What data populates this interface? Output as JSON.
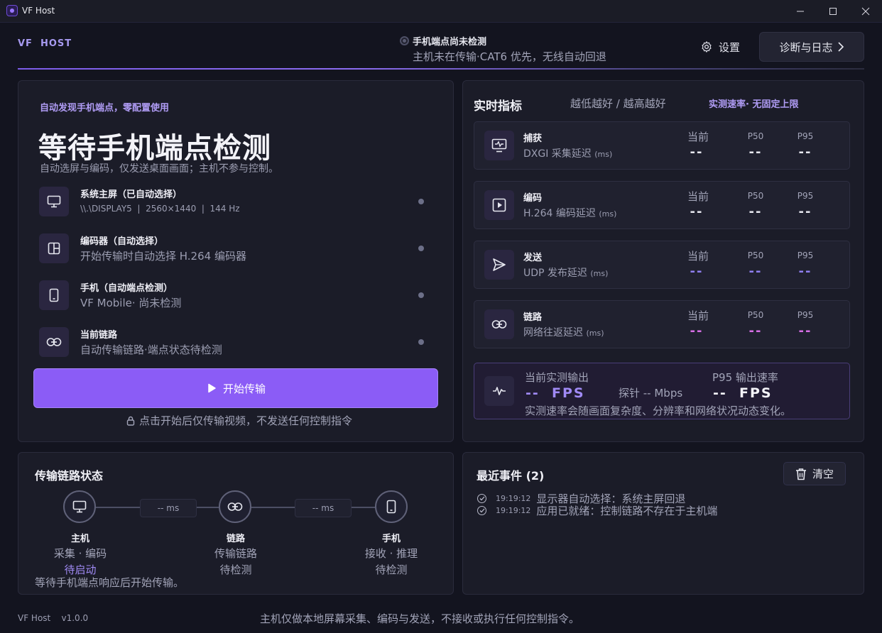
{
  "window": {
    "title": "VF Host",
    "minimize": "—",
    "maximize": "☐",
    "close": "✕"
  },
  "header": {
    "brand": "VF  HOST",
    "status_title": "手机端点尚未检测",
    "status_sub": "主机未在传输·CAT6 优先，无线自动回退",
    "settings_label": "设置",
    "diag_label": "诊断与日志",
    "diag_chevron": "›"
  },
  "main": {
    "tagline": "自动发现手机端点，零配置使用",
    "headline": "等待手机端点检测",
    "subline": "自动选屏与编码，仅发送桌面画面；主机不参与控制。",
    "rows": [
      {
        "title": "系统主屏（已自动选择）",
        "sub": "\\\\.\\DISPLAY5  |  2560×1440  |  144 Hz",
        "icon": "monitor-icon"
      },
      {
        "title": "编码器（自动选择）",
        "sub": "开始传输时自动选择 H.264 编码器",
        "icon": "encoder-icon"
      },
      {
        "title": "手机（自动端点检测）",
        "sub": "VF Mobile· 尚未检测",
        "icon": "phone-icon"
      },
      {
        "title": "当前链路",
        "sub": "自动传输链路·端点状态待检测",
        "icon": "link-icon"
      }
    ],
    "start_button": "开始传输",
    "lock_note": "点击开始后仅传输视频，不发送任何控制指令"
  },
  "metrics": {
    "title": "实时指标",
    "hint": "越低越好 / 越高越好",
    "rate_note": "实测速率· 无固定上限",
    "col_current": "当前",
    "col_p50": "P50",
    "col_p95": "P95",
    "cards": [
      {
        "name": "捕获",
        "sub": "DXGI 采集延迟",
        "unit": "(ms)",
        "cur": "--",
        "p50": "--",
        "p95": "--",
        "color": "#e6e7ef",
        "icon": "capture-icon"
      },
      {
        "name": "编码",
        "sub": "H.264 编码延迟",
        "unit": "(ms)",
        "cur": "--",
        "p50": "--",
        "p95": "--",
        "color": "#e6e7ef",
        "icon": "encode-icon"
      },
      {
        "name": "发送",
        "sub": "UDP 发布延迟",
        "unit": "(ms)",
        "cur": "--",
        "p50": "--",
        "p95": "--",
        "color": "#8f7ff0",
        "icon": "send-icon"
      },
      {
        "name": "链路",
        "sub": "网络往返延迟",
        "unit": "(ms)",
        "cur": "--",
        "p50": "--",
        "p95": "--",
        "color": "#d66ee6",
        "icon": "link-icon"
      }
    ],
    "fps": {
      "label_current": "当前实测输出",
      "value_current": "--",
      "unit_current": "FPS",
      "probe": "探针 -- Mbps",
      "label_p95": "P95 输出速率",
      "value_p95": "--",
      "unit_p95": "FPS",
      "note": "实测速率会随画面复杂度、分辨率和网络状况动态变化。"
    }
  },
  "link_status": {
    "title": "传输链路状态",
    "ms_left": "-- ms",
    "ms_right": "-- ms",
    "nodes": [
      {
        "title": "主机",
        "line1": "采集 · 编码",
        "line2": "待启动"
      },
      {
        "title": "链路",
        "line1": "传输链路",
        "line2": "待检测"
      },
      {
        "title": "手机",
        "line1": "接收 · 推理",
        "line2": "待检测"
      }
    ],
    "footer": "等待手机端点响应后开始传输。"
  },
  "events": {
    "title": "最近事件 (2)",
    "clear_label": "清空",
    "items": [
      {
        "time": "19:19:12",
        "text": "显示器自动选择：系统主屏回退"
      },
      {
        "time": "19:19:12",
        "text": "应用已就绪：控制链路不存在于主机端"
      }
    ]
  },
  "footer": {
    "version": "VF Host    v1.0.0",
    "note": "主机仅做本地屏幕采集、编码与发送，不接收或执行任何控制指令。"
  },
  "colors": {
    "accent": "#8b5cf6",
    "accent_text": "#b09cf5",
    "background": "#13141f",
    "panel": "#1b1c28"
  }
}
